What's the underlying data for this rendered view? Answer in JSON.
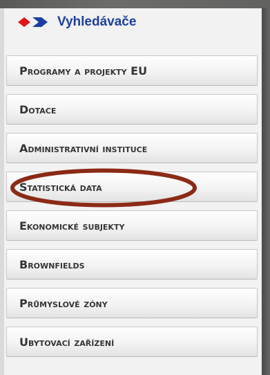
{
  "header": {
    "title": "Vyhledávače",
    "icon": "arrow-diamond-icon",
    "icon_colors": {
      "diamond": "#e0161b",
      "arrow": "#1d3fa0"
    }
  },
  "menu": {
    "items": [
      {
        "id": "programy",
        "label": "Programy a projekty EU"
      },
      {
        "id": "dotace",
        "label": "Dotace"
      },
      {
        "id": "administrativni",
        "label": "Administrativní instituce"
      },
      {
        "id": "statisticka",
        "label": "Statistická data",
        "highlighted": true
      },
      {
        "id": "ekonomicke",
        "label": "Ekonomické subjekty"
      },
      {
        "id": "brownfields",
        "label": "Brownfields"
      },
      {
        "id": "prumyslove",
        "label": "Průmyslové zóny"
      },
      {
        "id": "ubytovaci",
        "label": "Ubytovací zařízení"
      }
    ]
  },
  "highlight_color": "#8b2a16"
}
